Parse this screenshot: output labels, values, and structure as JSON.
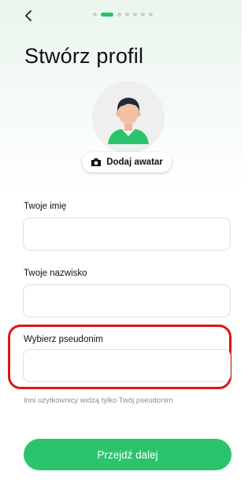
{
  "header": {
    "back_icon": "chevron-left-icon",
    "progress": {
      "total_steps": 7,
      "current_step": 2
    }
  },
  "page": {
    "title": "Stwórz profil"
  },
  "avatar": {
    "placeholder_icon": "person-avatar-icon",
    "add_button_icon": "camera-icon",
    "add_button_label": "Dodaj awatar"
  },
  "form": {
    "first_name": {
      "label": "Twoje imię",
      "value": "",
      "placeholder": ""
    },
    "last_name": {
      "label": "Twoje nazwisko",
      "value": "",
      "placeholder": ""
    },
    "nickname": {
      "label": "Wybierz pseudonim",
      "value": "",
      "placeholder": "",
      "hint": "Inni użytkownicy widzą tylko Twój pseudonim"
    }
  },
  "actions": {
    "next_label": "Przejdź dalej"
  },
  "colors": {
    "accent": "#2bc46c",
    "highlight": "#e01414",
    "background_top": "#eaf6ee"
  }
}
